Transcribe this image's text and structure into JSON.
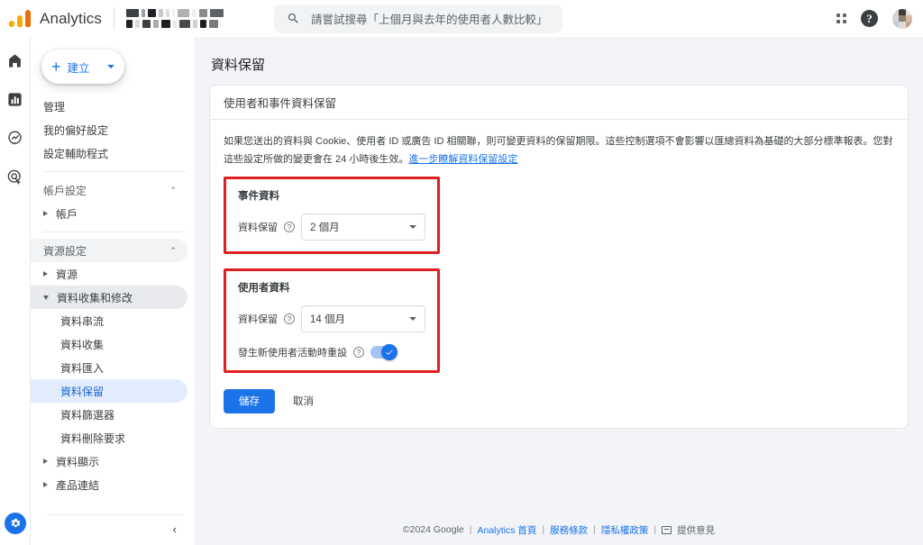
{
  "topbar": {
    "brand": "Analytics",
    "logo_icon": "analytics-logo-icon",
    "property_redacted": true,
    "search": {
      "placeholder": "請嘗試搜尋「上個月與去年的使用者人數比較」",
      "value": "",
      "icon": "search-icon"
    },
    "apps_icon": "apps-grid-icon",
    "help_icon": "help-question-icon",
    "help_glyph": "?",
    "avatar_icon": "user-avatar"
  },
  "rail": {
    "items": [
      {
        "icon": "home-icon",
        "selected": false
      },
      {
        "icon": "reports-bar-chart-icon",
        "selected": true
      },
      {
        "icon": "explore-compass-icon",
        "selected": false
      },
      {
        "icon": "advertising-target-icon",
        "selected": false
      }
    ],
    "admin_gear_icon": "admin-gear-icon"
  },
  "sidebar": {
    "create_button": {
      "label": "建立",
      "plus_icon": "plus-icon",
      "caret_icon": "chevron-down-icon"
    },
    "items": [
      {
        "label": "管理",
        "type": "link"
      },
      {
        "label": "我的偏好設定",
        "type": "link"
      },
      {
        "label": "設定輔助程式",
        "type": "link"
      }
    ],
    "account_group": {
      "label": "帳戶設定",
      "chevron": "⌃"
    },
    "account_item": {
      "label": "帳戶"
    },
    "property_group": {
      "label": "資源設定",
      "chevron": "⌃"
    },
    "property_item": {
      "label": "資源"
    },
    "data_collection": {
      "label": "資料收集和修改",
      "expanded": true
    },
    "sub_items": [
      {
        "label": "資料串流",
        "selected": false
      },
      {
        "label": "資料收集",
        "selected": false
      },
      {
        "label": "資料匯入",
        "selected": false
      },
      {
        "label": "資料保留",
        "selected": true
      },
      {
        "label": "資料篩選器",
        "selected": false
      },
      {
        "label": "資料刪除要求",
        "selected": false
      }
    ],
    "data_display": {
      "label": "資料顯示"
    },
    "product_links": {
      "label": "產品連結"
    },
    "collapse_icon": "chevron-left-icon",
    "collapse_glyph": "‹"
  },
  "main": {
    "page_title": "資料保留",
    "card_title": "使用者和事件資料保留",
    "description": "如果您送出的資料與 Cookie、使用者 ID 或廣告 ID 相關聯，則可變更資料的保留期限。這些控制選項不會影響以匯總資料為基礎的大部分標準報表。您對這些設定所做的變更會在 24 小時後生效。",
    "description_link": "進一步瞭解資料保留設定",
    "event_section": {
      "title": "事件資料",
      "retention_label": "資料保留",
      "help_icon": "help-circle-icon",
      "help_glyph": "?",
      "retention_value": "2 個月",
      "caret_icon": "chevron-down-icon",
      "highlighted": true
    },
    "user_section": {
      "title": "使用者資料",
      "retention_label": "資料保留",
      "help_icon": "help-circle-icon",
      "help_glyph": "?",
      "retention_value": "14 個月",
      "caret_icon": "chevron-down-icon",
      "reset_label": "發生新使用者活動時重設",
      "reset_help_icon": "help-circle-icon",
      "reset_help_glyph": "?",
      "reset_enabled": true,
      "toggle_check_glyph": "✓",
      "highlighted": true
    },
    "save_button": "儲存",
    "cancel_button": "取消"
  },
  "footer": {
    "copyright": "©2024 Google",
    "sep": "|",
    "home_link": "Analytics 首頁",
    "terms_link": "服務條款",
    "privacy_link": "隱私權政策",
    "feedback_icon": "feedback-icon",
    "feedback_label": "提供意見"
  },
  "colors": {
    "accent_blue": "#1a73e8",
    "highlight_red": "#e02020",
    "page_bg": "#f3f4f7",
    "selected_nav_bg": "#e3ecfd"
  }
}
